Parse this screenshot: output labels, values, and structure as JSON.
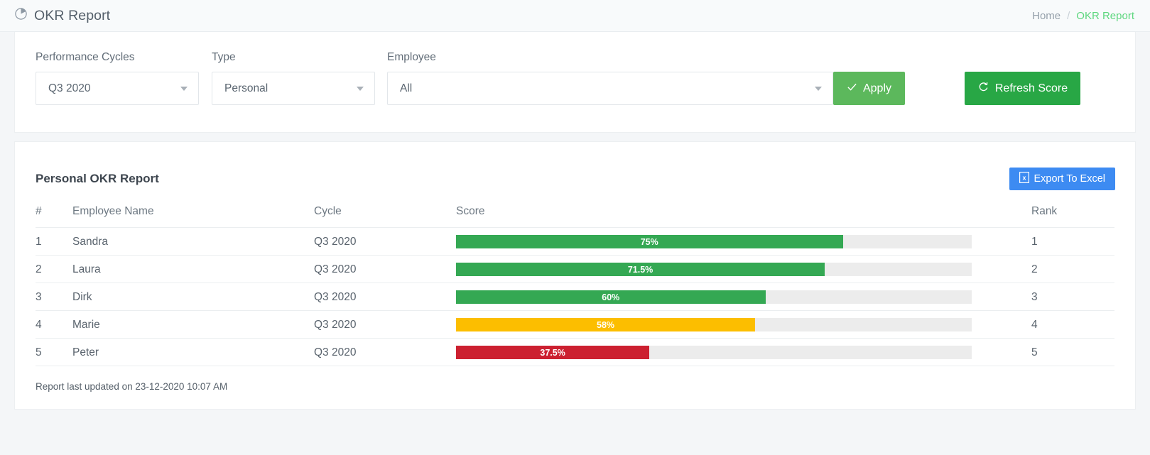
{
  "header": {
    "title": "OKR Report",
    "title_icon": "pie-chart-icon",
    "breadcrumb": {
      "home": "Home",
      "separator": "/",
      "current": "OKR Report"
    }
  },
  "filters": {
    "cycle": {
      "label": "Performance Cycles",
      "value": "Q3 2020"
    },
    "type": {
      "label": "Type",
      "value": "Personal"
    },
    "employee": {
      "label": "Employee",
      "value": "All"
    },
    "apply_button": {
      "label": "Apply",
      "icon": "check-icon",
      "color": "#5cb85c"
    },
    "refresh_button": {
      "label": "Refresh Score",
      "icon": "refresh-icon",
      "color": "#28a745"
    }
  },
  "report": {
    "title": "Personal OKR Report",
    "export_button": {
      "label": "Export To Excel",
      "icon": "file-excel-icon",
      "color": "#3d8bf2"
    },
    "columns": [
      "#",
      "Employee Name",
      "Cycle",
      "Score",
      "Rank"
    ],
    "rows": [
      {
        "num": "1",
        "name": "Sandra",
        "cycle": "Q3 2020",
        "score_label": "75%",
        "score": 75,
        "rank": "1",
        "color": "#34a853"
      },
      {
        "num": "2",
        "name": "Laura",
        "cycle": "Q3 2020",
        "score_label": "71.5%",
        "score": 71.5,
        "rank": "2",
        "color": "#34a853"
      },
      {
        "num": "3",
        "name": "Dirk",
        "cycle": "Q3 2020",
        "score_label": "60%",
        "score": 60,
        "rank": "3",
        "color": "#34a853"
      },
      {
        "num": "4",
        "name": "Marie",
        "cycle": "Q3 2020",
        "score_label": "58%",
        "score": 58,
        "rank": "4",
        "color": "#fcbe00"
      },
      {
        "num": "5",
        "name": "Peter",
        "cycle": "Q3 2020",
        "score_label": "37.5%",
        "score": 37.5,
        "rank": "5",
        "color": "#cc2030"
      }
    ],
    "footer": "Report last updated on 23-12-2020 10:07 AM"
  }
}
